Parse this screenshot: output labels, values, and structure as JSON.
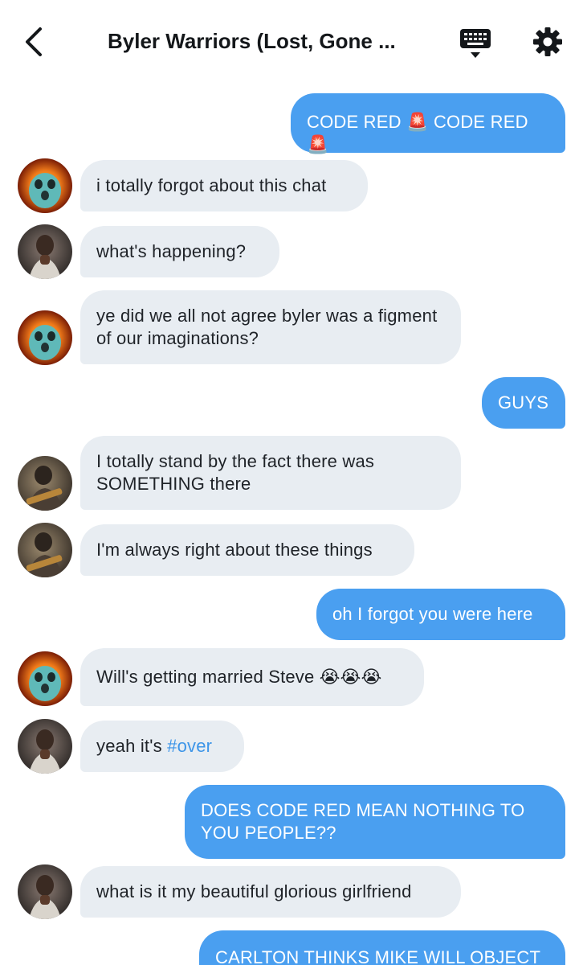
{
  "header": {
    "title": "Byler Warriors (Lost, Gone ...",
    "back_icon": "chevron-left-icon",
    "keyboard_icon": "keyboard-icon",
    "settings_icon": "gear-icon"
  },
  "colors": {
    "outgoing_bubble": "#4a9ff0",
    "incoming_bubble": "#e8edf2",
    "hashtag": "#3d95e8"
  },
  "messages": [
    {
      "direction": "out",
      "text": "CODE RED 🚨 CODE RED 🚨"
    },
    {
      "direction": "in",
      "avatar": "fiery-creature-avatar",
      "text": "i totally forgot about this chat"
    },
    {
      "direction": "in",
      "avatar": "person-avatar",
      "text": "what's happening?"
    },
    {
      "direction": "in",
      "avatar": "fiery-creature-avatar",
      "text": "ye did we all not agree byler was a figment of our imaginations?"
    },
    {
      "direction": "out",
      "text": "GUYS"
    },
    {
      "direction": "in",
      "avatar": "guitarist-avatar",
      "text": "I totally stand by the fact there was SOMETHING there"
    },
    {
      "direction": "in",
      "avatar": "guitarist-avatar",
      "text": "I'm always right about these things"
    },
    {
      "direction": "out",
      "text": "oh I forgot you were here"
    },
    {
      "direction": "in",
      "avatar": "fiery-creature-avatar",
      "text": "Will's getting married Steve 😭😭😭"
    },
    {
      "direction": "in",
      "avatar": "person-avatar",
      "text_prefix": "yeah it's ",
      "hashtag": "#over"
    },
    {
      "direction": "out",
      "text": "DOES CODE RED MEAN NOTHING TO YOU PEOPLE??"
    },
    {
      "direction": "in",
      "avatar": "person-avatar",
      "text": "what is it my beautiful glorious girlfriend"
    },
    {
      "direction": "out",
      "text": "CARLTON THINKS MIKE WILL OBJECT"
    }
  ]
}
